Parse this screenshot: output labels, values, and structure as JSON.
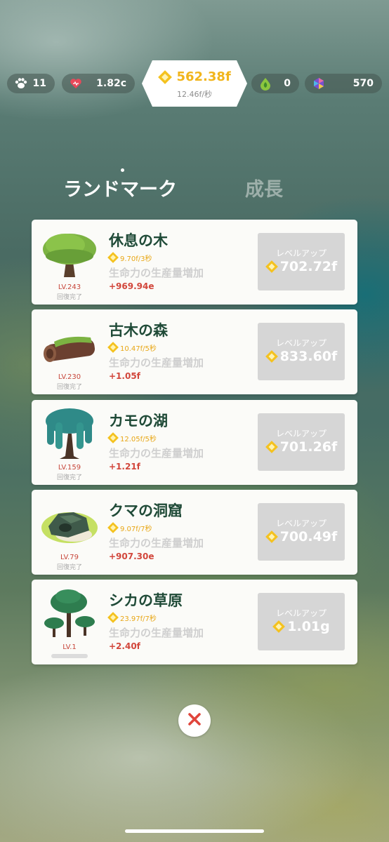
{
  "status_bar": {
    "paw": {
      "icon": "paw-icon",
      "value": "11"
    },
    "heart": {
      "icon": "heart-icon",
      "value": "1.82c"
    },
    "coin": {
      "icon": "coin-icon",
      "amount": "562.38f",
      "rate": "12.46f/秒"
    },
    "leaf": {
      "icon": "leaf-drop-icon",
      "value": "0"
    },
    "gem": {
      "icon": "gem-icon",
      "value": "570"
    }
  },
  "tabs": [
    {
      "label": "ランドマーク",
      "active": true
    },
    {
      "label": "成長",
      "active": false
    }
  ],
  "landmarks": [
    {
      "name": "休息の木",
      "rate": "9.70f/3秒",
      "description": "生命力の生産量増加",
      "bonus": "+969.94e",
      "level": "LV.243",
      "status": "回復完了",
      "button_label": "レベルアップ",
      "cost": "702.72f",
      "thumb_icon": "rest-tree-icon"
    },
    {
      "name": "古木の森",
      "rate": "10.47f/5秒",
      "description": "生命力の生産量増加",
      "bonus": "+1.05f",
      "level": "LV.230",
      "status": "回復完了",
      "button_label": "レベルアップ",
      "cost": "833.60f",
      "thumb_icon": "old-log-icon"
    },
    {
      "name": "カモの湖",
      "rate": "12.05f/5秒",
      "description": "生命力の生産量増加",
      "bonus": "+1.21f",
      "level": "LV.159",
      "status": "回復完了",
      "button_label": "レベルアップ",
      "cost": "701.26f",
      "thumb_icon": "willow-tree-icon"
    },
    {
      "name": "クマの洞窟",
      "rate": "9.07f/7秒",
      "description": "生命力の生産量増加",
      "bonus": "+907.30e",
      "level": "LV.79",
      "status": "回復完了",
      "button_label": "レベルアップ",
      "cost": "700.49f",
      "thumb_icon": "bear-cave-icon"
    },
    {
      "name": "シカの草原",
      "rate": "23.97f/7秒",
      "description": "生命力の生産量増加",
      "bonus": "+2.40f",
      "level": "LV.1",
      "status": "",
      "progress": 0,
      "button_label": "レベルアップ",
      "cost": "1.01g",
      "thumb_icon": "meadow-trees-icon"
    }
  ],
  "close": {
    "icon": "close-icon"
  },
  "colors": {
    "accent_gold": "#f1b51c",
    "title_green": "#1f4a37",
    "bonus_red": "#d2473c"
  }
}
